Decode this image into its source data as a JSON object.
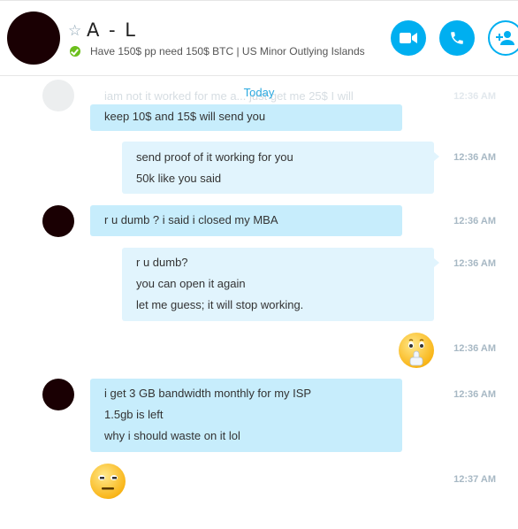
{
  "header": {
    "contact_name": "A - L",
    "mood_message": "Have 150$ pp need 150$ BTC | US Minor Outlying Islands",
    "icons": [
      "star-icon",
      "online-status-icon",
      "video-call-icon",
      "audio-call-icon",
      "add-people-icon"
    ]
  },
  "chat": {
    "date_separator": "Today",
    "faded_message": "iam not it worked for me a... just get me 25$ I will",
    "faded_time": "12:36 AM",
    "messages": [
      {
        "lines": [
          "keep 10$ and 15$ will send you"
        ]
      },
      {
        "lines": [
          "send proof of it working for you",
          "50k like you said"
        ],
        "time": "12:36 AM"
      },
      {
        "lines": [
          "r u dumb ? i said i closed my MBA"
        ],
        "time": "12:36 AM"
      },
      {
        "lines": [
          "r u dumb?",
          "you can open it again",
          "let me guess; it will stop working."
        ],
        "time": "12:36 AM"
      },
      {
        "emoji": "shushing-face-emoji",
        "time": "12:36 AM"
      },
      {
        "lines": [
          "i get 3 GB bandwidth monthly for my ISP",
          "1.5gb is left",
          "why i should waste on it lol"
        ],
        "time": "12:36 AM"
      },
      {
        "emoji": "neutral-face-emoji",
        "time": "12:37 AM"
      }
    ]
  },
  "colors": {
    "accent": "#00aff0",
    "incoming_bubble": "#c7edfc",
    "outgoing_bubble": "#e1f4fd",
    "online": "#6cbf1c",
    "today_label": "#2aa9e0"
  }
}
